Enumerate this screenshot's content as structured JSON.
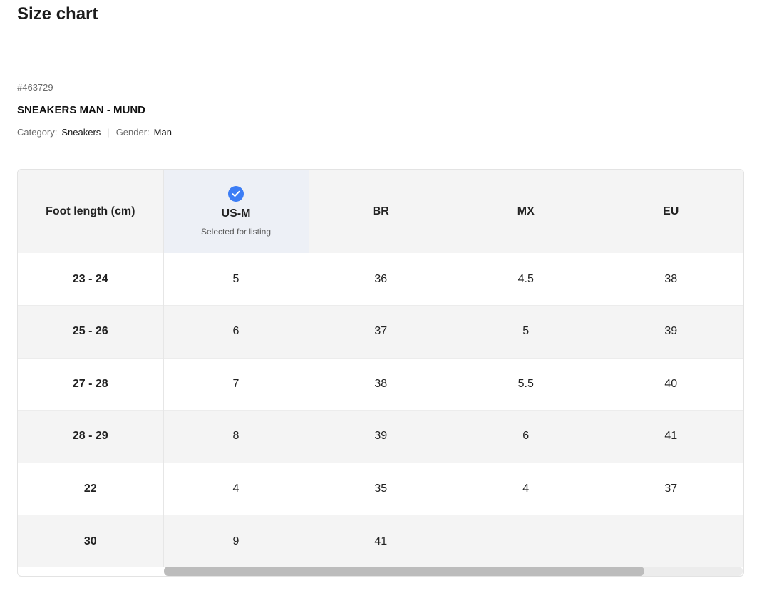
{
  "page": {
    "title": "Size chart"
  },
  "product": {
    "id": "#463729",
    "name": "SNEAKERS MAN - MUND",
    "category_label": "Category:",
    "category_value": "Sneakers",
    "gender_label": "Gender:",
    "gender_value": "Man"
  },
  "table": {
    "columns": [
      {
        "label": "Foot length (cm)"
      },
      {
        "label": "US-M",
        "selected": true,
        "note": "Selected for listing"
      },
      {
        "label": "BR"
      },
      {
        "label": "MX"
      },
      {
        "label": "EU"
      }
    ],
    "rows": [
      [
        "23 - 24",
        "5",
        "36",
        "4.5",
        "38"
      ],
      [
        "25 - 26",
        "6",
        "37",
        "5",
        "39"
      ],
      [
        "27 - 28",
        "7",
        "38",
        "5.5",
        "40"
      ],
      [
        "28 - 29",
        "8",
        "39",
        "6",
        "41"
      ],
      [
        "22",
        "4",
        "35",
        "4",
        "37"
      ],
      [
        "30",
        "9",
        "41",
        "",
        ""
      ]
    ]
  },
  "scrollbar": {
    "horizontal_position_fraction": 0.0,
    "visible_fraction": 0.83
  },
  "colors": {
    "accent": "#3c7df5",
    "selected_column_bg": "#edf0f6",
    "stripe_bg": "#f4f4f4"
  },
  "icons": {
    "selected": "check-circle-icon"
  }
}
